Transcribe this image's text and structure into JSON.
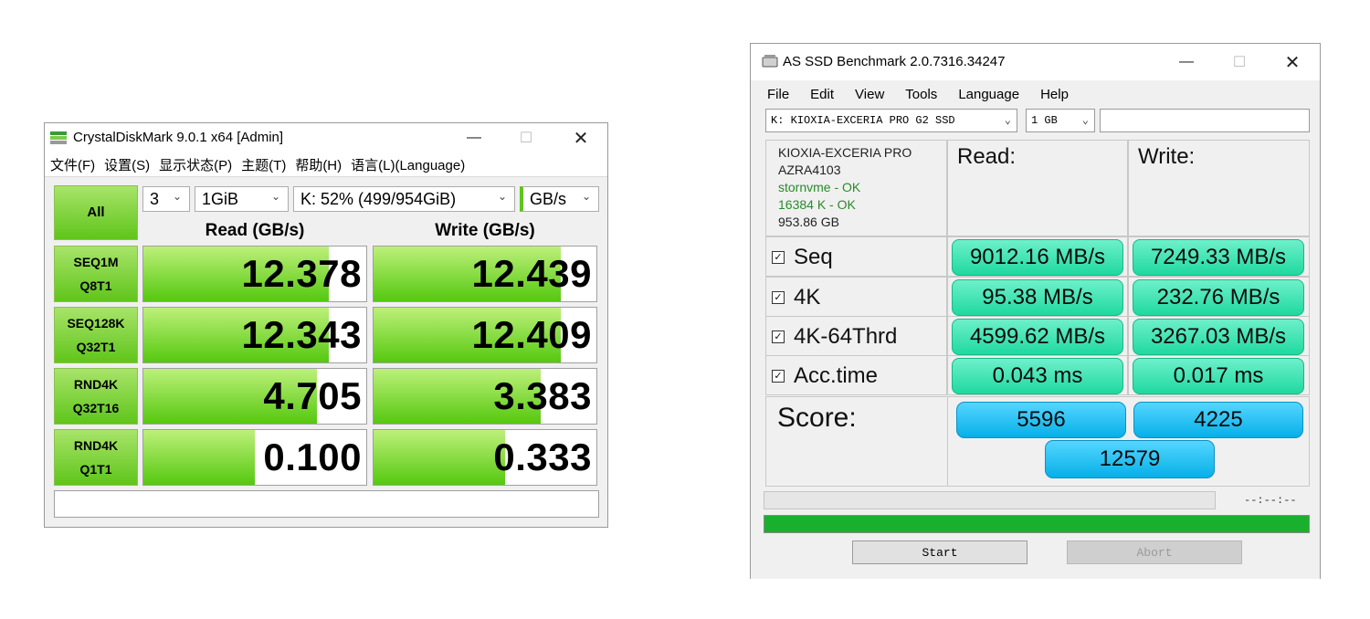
{
  "cdm": {
    "title": "CrystalDiskMark 9.0.1 x64 [Admin]",
    "menu": [
      "文件(F)",
      "设置(S)",
      "显示状态(P)",
      "主题(T)",
      "帮助(H)",
      "语言(L)(Language)"
    ],
    "count": "3",
    "size": "1GiB",
    "drive": "K: 52% (499/954GiB)",
    "unit": "GB/s",
    "all_label": "All",
    "read_header": "Read (GB/s)",
    "write_header": "Write (GB/s)",
    "rows": [
      {
        "line1": "SEQ1M",
        "line2": "Q8T1",
        "read": "12.378",
        "write": "12.439",
        "read_fill": 0.83,
        "write_fill": 0.84
      },
      {
        "line1": "SEQ128K",
        "line2": "Q32T1",
        "read": "12.343",
        "write": "12.409",
        "read_fill": 0.83,
        "write_fill": 0.84
      },
      {
        "line1": "RND4K",
        "line2": "Q32T16",
        "read": "4.705",
        "write": "3.383",
        "read_fill": 0.78,
        "write_fill": 0.75
      },
      {
        "line1": "RND4K",
        "line2": "Q1T1",
        "read": "0.100",
        "write": "0.333",
        "read_fill": 0.5,
        "write_fill": 0.59
      }
    ],
    "accent": "#5fc51a"
  },
  "asssd": {
    "title": "AS SSD Benchmark 2.0.7316.34247",
    "menu": [
      "File",
      "Edit",
      "View",
      "Tools",
      "Language",
      "Help"
    ],
    "drive": "K: KIOXIA-EXCERIA PRO G2 SSD",
    "size": "1 GB",
    "info": {
      "model": "KIOXIA-EXCERIA PRO",
      "firmware": "AZRA4103",
      "driver": "stornvme - OK",
      "alignment": "16384 K - OK",
      "capacity": "953.86 GB"
    },
    "read_header": "Read:",
    "write_header": "Write:",
    "rows": [
      {
        "label": "Seq",
        "read": "9012.16 MB/s",
        "write": "7249.33 MB/s"
      },
      {
        "label": "4K",
        "read": "95.38 MB/s",
        "write": "232.76 MB/s"
      },
      {
        "label": "4K-64Thrd",
        "read": "4599.62 MB/s",
        "write": "3267.03 MB/s"
      },
      {
        "label": "Acc.time",
        "read": "0.043 ms",
        "write": "0.017 ms"
      }
    ],
    "score_label": "Score:",
    "score_read": "5596",
    "score_write": "4225",
    "score_total": "12579",
    "time": "--:--:--",
    "progress": 1.0,
    "start_label": "Start",
    "abort_label": "Abort",
    "accent": "#19b02e"
  }
}
